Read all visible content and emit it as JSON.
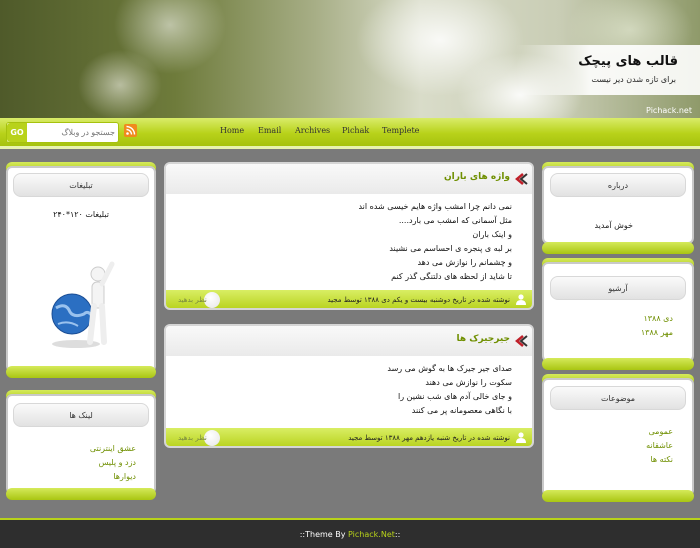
{
  "header": {
    "title": "قالب های پیچک",
    "description": "برای تازه شدن دیر نیست",
    "credit": "Pichack.net"
  },
  "search": {
    "go_label": "GO",
    "placeholder": "جستجو در وبلاگ"
  },
  "nav": {
    "items": [
      "Home",
      "Email",
      "Archives",
      "Pichak",
      "Templete"
    ]
  },
  "sidebar_right": {
    "about": {
      "title": "درباره",
      "text": "خوش آمدید"
    },
    "archive": {
      "title": "آرشیو",
      "items": [
        "دی ۱۳۸۸",
        "مهر ۱۳۸۸"
      ]
    },
    "topics": {
      "title": "موضوعات",
      "items": [
        "عمومی",
        "عاشقانه",
        "نکته ها"
      ]
    }
  },
  "sidebar_left": {
    "ads": {
      "title": "تبلیغات",
      "banner_text": "تبلیغات ۱۲۰*۲۴۰"
    },
    "links": {
      "title": "لینک ها",
      "items": [
        "عشق اینترنتی",
        "دزد و پلیس",
        "دیوارها"
      ]
    }
  },
  "posts": [
    {
      "title": "واژه های باران",
      "lines": [
        "نمی دانم چرا امشب واژه هایم خیسی شده اند",
        "مثل آسمانی که امشب می بارد....",
        "و اینک باران",
        "بر لبه ی پنجره ی احساسم می نشیند",
        "و چشمانم را نوازش می دهد",
        "تا شاید از لحظه های دلتنگی گذر کنم"
      ],
      "meta": "نوشته شده در تاریخ دوشنبه بیست و یکم دی ۱۳۸۸ توسط مجید",
      "comment_label": "نظر بدهید"
    },
    {
      "title": "جیرجیرک ها",
      "lines": [
        "صدای جیر جیرک ها به گوش می رسد",
        "سکوت را نوازش می دهند",
        "و جای خالی آدم های شب نشین را",
        "با نگاهی معصومانه پر می کنند"
      ],
      "meta": "نوشته شده در تاریخ شنبه یازدهم مهر ۱۳۸۸ توسط مجید",
      "comment_label": "نظر بدهید"
    }
  ],
  "footer": {
    "prefix": "::Theme By ",
    "brand": "Pichack.Net",
    "suffix": "::"
  },
  "colors": {
    "accent": "#b8d21a",
    "accent_dark": "#6f8f00",
    "background": "#7a7a7a",
    "footer": "#2e2e2e"
  }
}
